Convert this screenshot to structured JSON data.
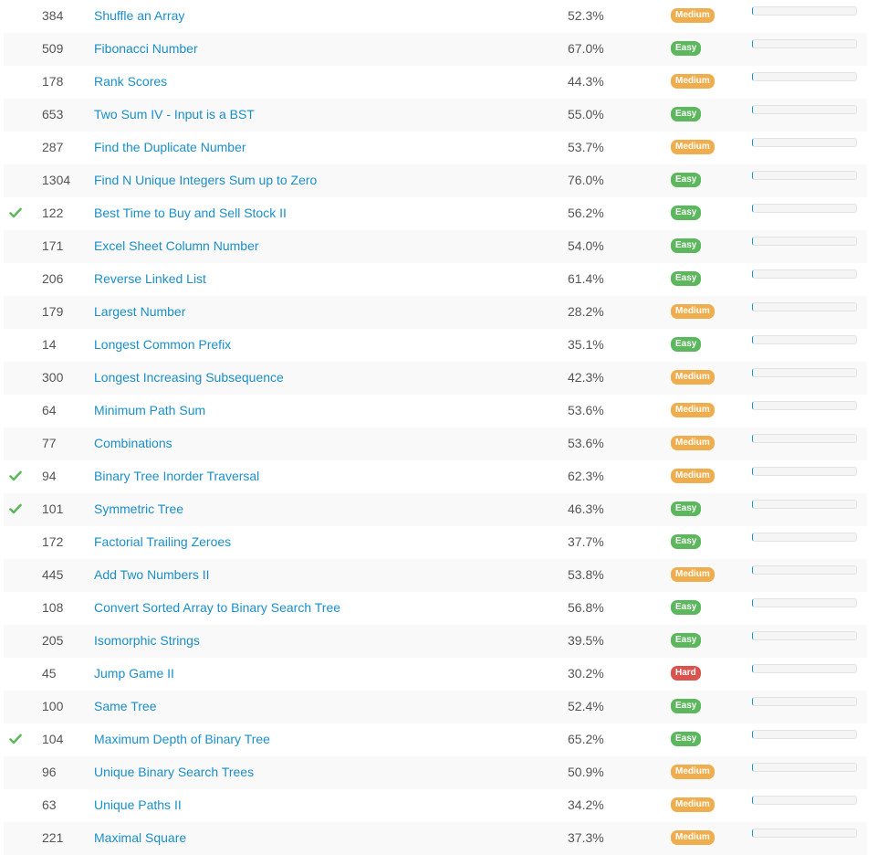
{
  "problems": [
    {
      "solved": false,
      "id": "384",
      "title": "Shuffle an Array",
      "acceptance": "52.3%",
      "difficulty": "Medium"
    },
    {
      "solved": false,
      "id": "509",
      "title": "Fibonacci Number",
      "acceptance": "67.0%",
      "difficulty": "Easy"
    },
    {
      "solved": false,
      "id": "178",
      "title": "Rank Scores",
      "acceptance": "44.3%",
      "difficulty": "Medium"
    },
    {
      "solved": false,
      "id": "653",
      "title": "Two Sum IV - Input is a BST",
      "acceptance": "55.0%",
      "difficulty": "Easy"
    },
    {
      "solved": false,
      "id": "287",
      "title": "Find the Duplicate Number",
      "acceptance": "53.7%",
      "difficulty": "Medium"
    },
    {
      "solved": false,
      "id": "1304",
      "title": "Find N Unique Integers Sum up to Zero",
      "acceptance": "76.0%",
      "difficulty": "Easy"
    },
    {
      "solved": true,
      "id": "122",
      "title": "Best Time to Buy and Sell Stock II",
      "acceptance": "56.2%",
      "difficulty": "Easy"
    },
    {
      "solved": false,
      "id": "171",
      "title": "Excel Sheet Column Number",
      "acceptance": "54.0%",
      "difficulty": "Easy"
    },
    {
      "solved": false,
      "id": "206",
      "title": "Reverse Linked List",
      "acceptance": "61.4%",
      "difficulty": "Easy"
    },
    {
      "solved": false,
      "id": "179",
      "title": "Largest Number",
      "acceptance": "28.2%",
      "difficulty": "Medium"
    },
    {
      "solved": false,
      "id": "14",
      "title": "Longest Common Prefix",
      "acceptance": "35.1%",
      "difficulty": "Easy"
    },
    {
      "solved": false,
      "id": "300",
      "title": "Longest Increasing Subsequence",
      "acceptance": "42.3%",
      "difficulty": "Medium"
    },
    {
      "solved": false,
      "id": "64",
      "title": "Minimum Path Sum",
      "acceptance": "53.6%",
      "difficulty": "Medium"
    },
    {
      "solved": false,
      "id": "77",
      "title": "Combinations",
      "acceptance": "53.6%",
      "difficulty": "Medium"
    },
    {
      "solved": true,
      "id": "94",
      "title": "Binary Tree Inorder Traversal",
      "acceptance": "62.3%",
      "difficulty": "Medium"
    },
    {
      "solved": true,
      "id": "101",
      "title": "Symmetric Tree",
      "acceptance": "46.3%",
      "difficulty": "Easy"
    },
    {
      "solved": false,
      "id": "172",
      "title": "Factorial Trailing Zeroes",
      "acceptance": "37.7%",
      "difficulty": "Easy"
    },
    {
      "solved": false,
      "id": "445",
      "title": "Add Two Numbers II",
      "acceptance": "53.8%",
      "difficulty": "Medium"
    },
    {
      "solved": false,
      "id": "108",
      "title": "Convert Sorted Array to Binary Search Tree",
      "acceptance": "56.8%",
      "difficulty": "Easy"
    },
    {
      "solved": false,
      "id": "205",
      "title": "Isomorphic Strings",
      "acceptance": "39.5%",
      "difficulty": "Easy"
    },
    {
      "solved": false,
      "id": "45",
      "title": "Jump Game II",
      "acceptance": "30.2%",
      "difficulty": "Hard"
    },
    {
      "solved": false,
      "id": "100",
      "title": "Same Tree",
      "acceptance": "52.4%",
      "difficulty": "Easy"
    },
    {
      "solved": true,
      "id": "104",
      "title": "Maximum Depth of Binary Tree",
      "acceptance": "65.2%",
      "difficulty": "Easy"
    },
    {
      "solved": false,
      "id": "96",
      "title": "Unique Binary Search Trees",
      "acceptance": "50.9%",
      "difficulty": "Medium"
    },
    {
      "solved": false,
      "id": "63",
      "title": "Unique Paths II",
      "acceptance": "34.2%",
      "difficulty": "Medium"
    },
    {
      "solved": false,
      "id": "221",
      "title": "Maximal Square",
      "acceptance": "37.3%",
      "difficulty": "Medium"
    }
  ],
  "colors": {
    "link": "#1a8fc9",
    "easy": "#5cb85c",
    "medium": "#f0ad4e",
    "hard": "#d9534f",
    "check": "#5cb85c"
  },
  "icons": {
    "solved": "check-icon"
  }
}
